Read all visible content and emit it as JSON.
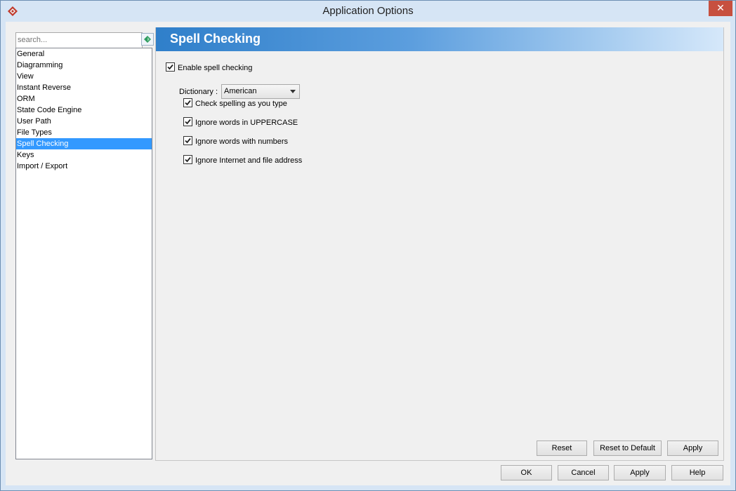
{
  "window": {
    "title": "Application Options",
    "close_glyph": "✕"
  },
  "search": {
    "placeholder": "search..."
  },
  "tree": {
    "items": [
      {
        "label": "General"
      },
      {
        "label": "Diagramming"
      },
      {
        "label": "View"
      },
      {
        "label": "Instant Reverse"
      },
      {
        "label": "ORM"
      },
      {
        "label": "State Code Engine"
      },
      {
        "label": "User Path"
      },
      {
        "label": "File Types"
      },
      {
        "label": "Spell Checking",
        "selected": true
      },
      {
        "label": "Keys"
      },
      {
        "label": "Import / Export"
      }
    ]
  },
  "panel": {
    "title": "Spell Checking",
    "enable_label": "Enable spell checking",
    "enable_checked": true,
    "dictionary_label": "Dictionary :",
    "dictionary_value": "American",
    "options": [
      {
        "label": "Check spelling as you type",
        "checked": true
      },
      {
        "label": "Ignore words in UPPERCASE",
        "checked": true
      },
      {
        "label": "Ignore words with numbers",
        "checked": true
      },
      {
        "label": "Ignore Internet and file address",
        "checked": true
      }
    ],
    "reset_label": "Reset",
    "reset_default_label": "Reset to Default",
    "apply_label": "Apply"
  },
  "footer": {
    "ok_label": "OK",
    "cancel_label": "Cancel",
    "apply_label": "Apply",
    "help_label": "Help"
  },
  "colors": {
    "selection": "#3399ff",
    "header_start": "#2f7fca",
    "close": "#c7503f"
  }
}
